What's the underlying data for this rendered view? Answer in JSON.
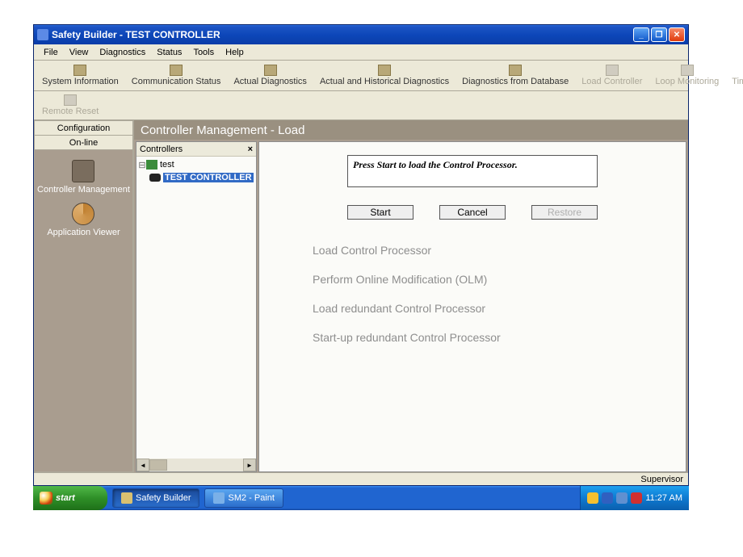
{
  "window": {
    "title": "Safety Builder - TEST CONTROLLER"
  },
  "menubar": [
    "File",
    "View",
    "Diagnostics",
    "Status",
    "Tools",
    "Help"
  ],
  "toolbar": {
    "items": [
      {
        "label": "System Information",
        "enabled": true
      },
      {
        "label": "Communication Status",
        "enabled": true
      },
      {
        "label": "Actual Diagnostics",
        "enabled": true
      },
      {
        "label": "Actual and Historical Diagnostics",
        "enabled": true
      },
      {
        "label": "Diagnostics from Database",
        "enabled": true
      },
      {
        "label": "Load Controller",
        "enabled": false
      },
      {
        "label": "Loop Monitoring",
        "enabled": false
      },
      {
        "label": "Time Synchronization",
        "enabled": false
      }
    ],
    "row2": {
      "remote_reset": "Remote Reset"
    }
  },
  "left_tabs": {
    "config": "Configuration",
    "online": "On-line"
  },
  "side_items": {
    "ctrl_mgmt": "Controller Management",
    "app_viewer": "Application Viewer"
  },
  "page": {
    "title": "Controller Management - Load",
    "tree_header": "Controllers",
    "tree_root": "test",
    "tree_selected": "TEST CONTROLLER",
    "message": "Press Start to load the Control Processor.",
    "buttons": {
      "start": "Start",
      "cancel": "Cancel",
      "restore": "Restore"
    },
    "tasks": [
      "Load Control Processor",
      "Perform Online Modification (OLM)",
      "Load redundant Control Processor",
      "Start-up redundant Control Processor"
    ]
  },
  "status": {
    "user": "Supervisor"
  },
  "taskbar": {
    "start": "start",
    "tabs": [
      {
        "label": "Safety Builder",
        "active": true
      },
      {
        "label": "SM2 - Paint",
        "active": false
      }
    ],
    "clock": "11:27 AM"
  }
}
